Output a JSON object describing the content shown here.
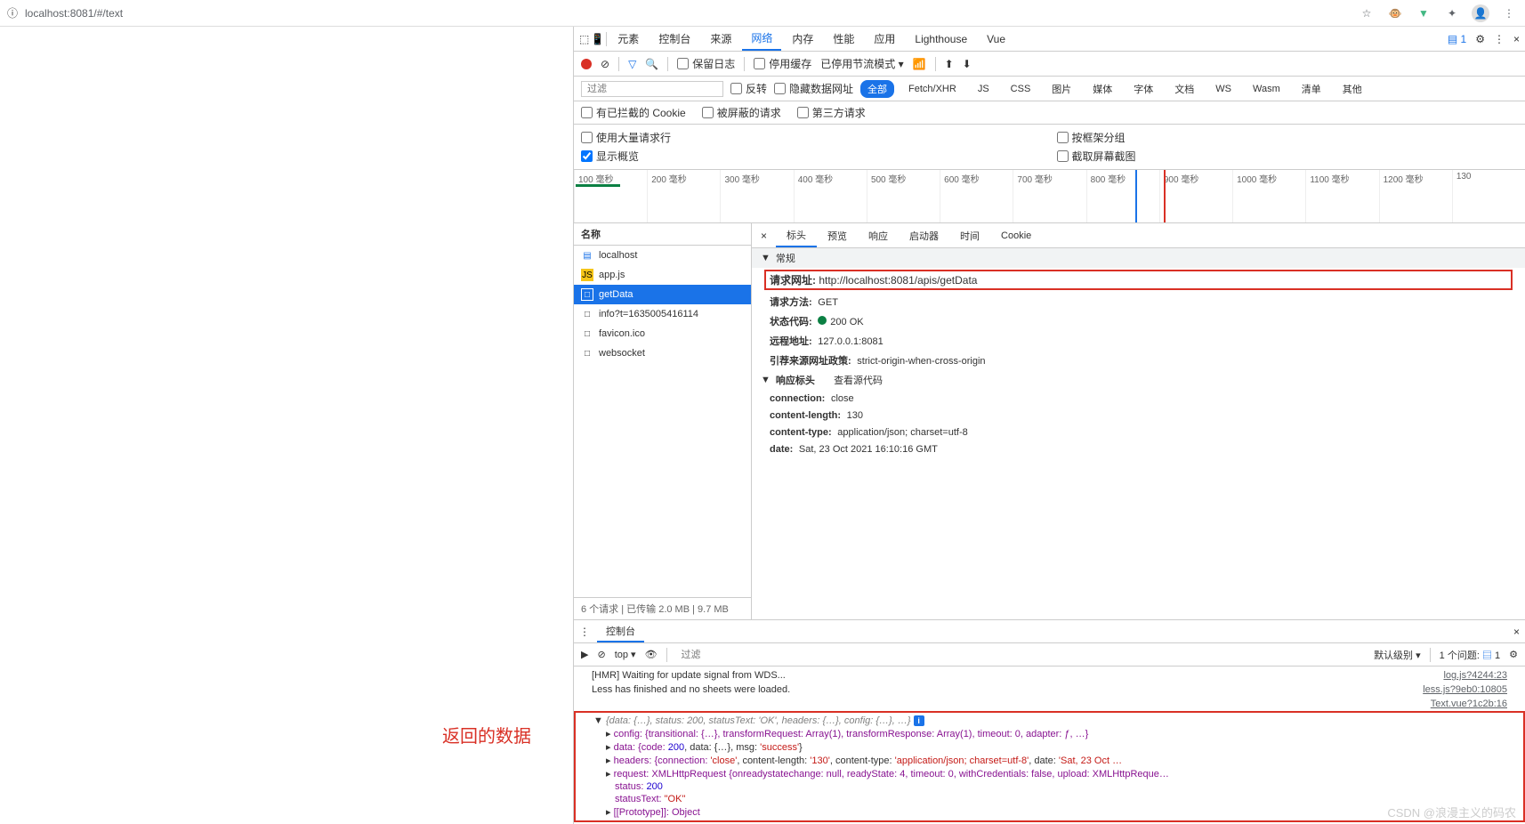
{
  "browser": {
    "url": "localhost:8081/#/text",
    "ext_icons": [
      "star-icon",
      "monkey-icon",
      "vue-icon",
      "puzzle-icon",
      "user-icon",
      "more-icon"
    ]
  },
  "devtools": {
    "tabs": [
      "元素",
      "控制台",
      "来源",
      "网络",
      "内存",
      "性能",
      "应用",
      "Lighthouse",
      "Vue"
    ],
    "active_tab": "网络",
    "msg_count": "1",
    "toolbar": {
      "preserve_log": "保留日志",
      "disable_cache": "停用缓存",
      "throttling": "已停用节流模式"
    },
    "filter": {
      "placeholder": "过滤",
      "invert": "反转",
      "hide_data": "隐藏数据网址",
      "types": [
        "全部",
        "Fetch/XHR",
        "JS",
        "CSS",
        "图片",
        "媒体",
        "字体",
        "文档",
        "WS",
        "Wasm",
        "清单",
        "其他"
      ],
      "active_type": "全部",
      "blocked_cookies": "有已拦截的 Cookie",
      "blocked_req": "被屏蔽的请求",
      "third_party": "第三方请求"
    },
    "options": {
      "large_rows": "使用大量请求行",
      "group_frame": "按框架分组",
      "show_overview": "显示概览",
      "screenshot": "截取屏幕截图"
    },
    "timeline_ticks": [
      "100 毫秒",
      "200 毫秒",
      "300 毫秒",
      "400 毫秒",
      "500 毫秒",
      "600 毫秒",
      "700 毫秒",
      "800 毫秒",
      "900 毫秒",
      "1000 毫秒",
      "1100 毫秒",
      "1200 毫秒",
      "130"
    ],
    "requests": {
      "header": "名称",
      "items": [
        {
          "name": "localhost",
          "icon": "doc",
          "color": "#1a73e8"
        },
        {
          "name": "app.js",
          "icon": "js",
          "color": "#f5c518"
        },
        {
          "name": "getData",
          "icon": "file",
          "color": "#fff",
          "selected": true
        },
        {
          "name": "info?t=1635005416114",
          "icon": "file",
          "color": "#666"
        },
        {
          "name": "favicon.ico",
          "icon": "file",
          "color": "#666"
        },
        {
          "name": "websocket",
          "icon": "file",
          "color": "#666"
        }
      ],
      "footer": "6 个请求  |  已传输 2.0 MB  |  9.7 MB"
    },
    "detail": {
      "tabs": [
        "标头",
        "预览",
        "响应",
        "启动器",
        "时间",
        "Cookie"
      ],
      "active": "标头",
      "general_hdr": "常规",
      "url_label": "请求网址:",
      "url": "http://localhost:8081/apis/getData",
      "method_label": "请求方法:",
      "method": "GET",
      "status_label": "状态代码:",
      "status": "200 OK",
      "remote_label": "远程地址:",
      "remote": "127.0.0.1:8081",
      "referrer_label": "引荐来源网址政策:",
      "referrer": "strict-origin-when-cross-origin",
      "resp_hdr": "响应标头",
      "view_source": "查看源代码",
      "headers": [
        {
          "k": "connection:",
          "v": "close"
        },
        {
          "k": "content-length:",
          "v": "130"
        },
        {
          "k": "content-type:",
          "v": "application/json; charset=utf-8"
        },
        {
          "k": "date:",
          "v": "Sat, 23 Oct 2021 16:10:16 GMT"
        }
      ]
    }
  },
  "console": {
    "tab": "控制台",
    "top": "top",
    "filter_ph": "过滤",
    "level": "默认级别",
    "issues": "1 个问题:",
    "issue_count": "1",
    "lines": [
      {
        "text": "[HMR] Waiting for update signal from WDS...",
        "src": "log.js?4244:23"
      },
      {
        "text": "Less has finished and no sheets were loaded.",
        "src": "less.js?9eb0:10805"
      },
      {
        "text": "",
        "src": "Text.vue?1c2b:16"
      }
    ],
    "red_label": "返回的数据",
    "obj": {
      "summary": "{data: {…}, status: 200, statusText: 'OK', headers: {…}, config: {…}, …}",
      "config": "config: {transitional: {…}, transformRequest: Array(1), transformResponse: Array(1), timeout: 0, adapter: ƒ, …}",
      "data_pre": "data: {code: ",
      "data_code": "200",
      "data_mid": ", data: {…}, msg: ",
      "data_msg": "'success'",
      "data_post": "}",
      "headers_pre": "headers: {connection: ",
      "h_conn": "'close'",
      "h_mid1": ", content-length: ",
      "h_len": "'130'",
      "h_mid2": ", content-type: ",
      "h_ct": "'application/json; charset=utf-8'",
      "h_mid3": ", date: ",
      "h_date": "'Sat, 23 Oct …",
      "request": "request: XMLHttpRequest {onreadystatechange: null, readyState: 4, timeout: 0, withCredentials: false, upload: XMLHttpReque…",
      "status_k": "status: ",
      "status_v": "200",
      "statusText_k": "statusText: ",
      "statusText_v": "\"OK\"",
      "proto": "[[Prototype]]: Object"
    }
  },
  "watermark": "CSDN @浪漫主义的码农"
}
